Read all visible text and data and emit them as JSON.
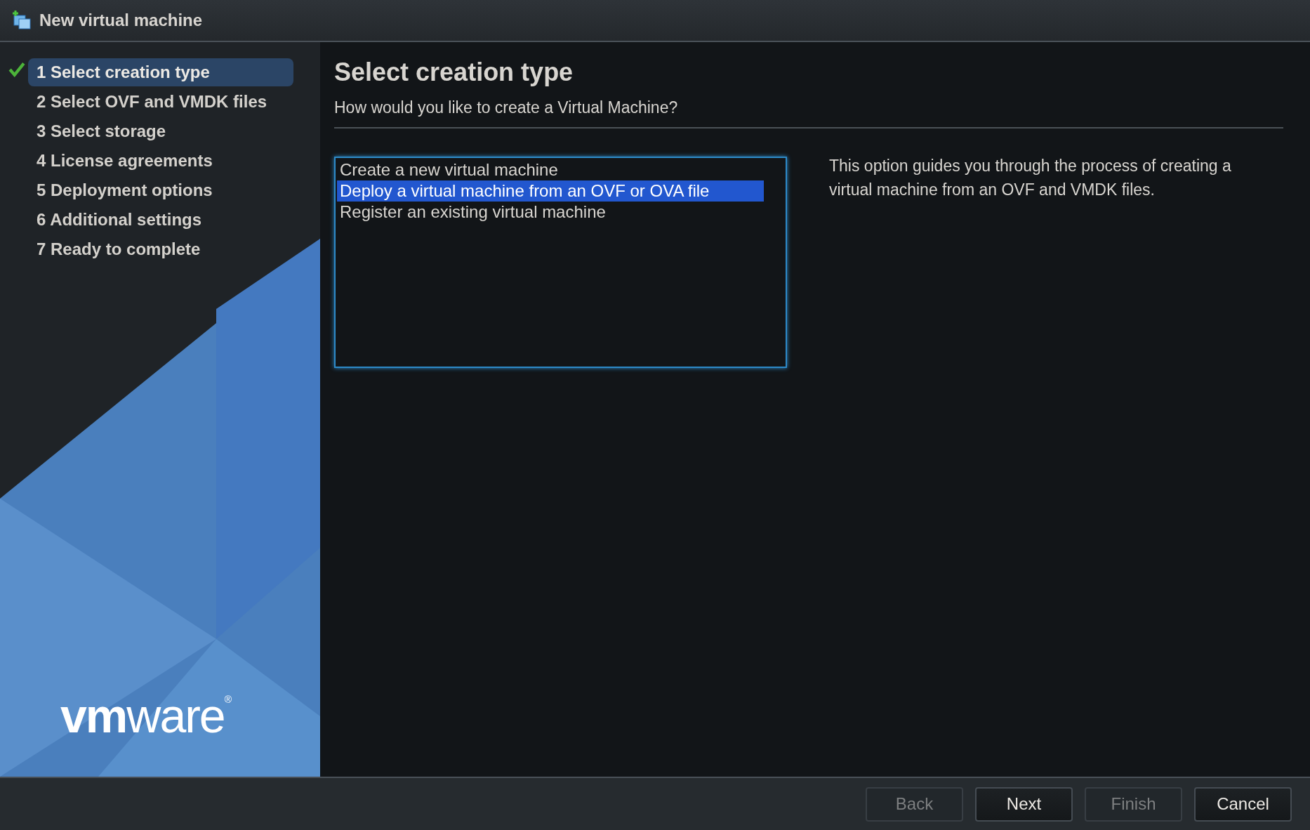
{
  "window": {
    "title": "New virtual machine"
  },
  "steps": [
    {
      "label": "1 Select creation type",
      "selected": true,
      "checked": true
    },
    {
      "label": "2 Select OVF and VMDK files",
      "selected": false,
      "checked": false
    },
    {
      "label": "3 Select storage",
      "selected": false,
      "checked": false
    },
    {
      "label": "4 License agreements",
      "selected": false,
      "checked": false
    },
    {
      "label": "5 Deployment options",
      "selected": false,
      "checked": false
    },
    {
      "label": "6 Additional settings",
      "selected": false,
      "checked": false
    },
    {
      "label": "7 Ready to complete",
      "selected": false,
      "checked": false
    }
  ],
  "logo": "**vm**ware$^{®}$",
  "page": {
    "title": "Select creation type",
    "subtitle": "How would you like to create a Virtual Machine?",
    "options": [
      {
        "label": "Create a new virtual machine",
        "selected": false
      },
      {
        "label": "Deploy a virtual machine from an OVF or OVA file",
        "selected": true
      },
      {
        "label": "Register an existing virtual machine",
        "selected": false
      }
    ],
    "description": "This option guides you through the process of creating a virtual machine from an OVF and VMDK files."
  },
  "buttons": [
    {
      "label": "Back",
      "disabled": true
    },
    {
      "label": "Next",
      "disabled": false
    },
    {
      "label": "Finish",
      "disabled": true
    },
    {
      "label": "Cancel",
      "disabled": false
    }
  ]
}
